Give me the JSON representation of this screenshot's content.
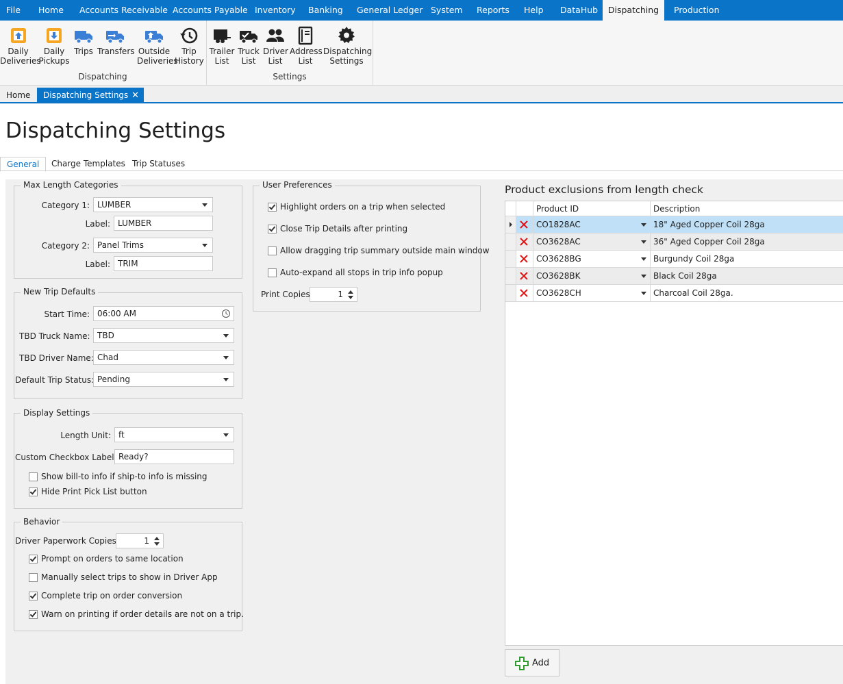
{
  "menu": [
    "File",
    "Home",
    "Accounts Receivable",
    "Accounts Payable",
    "Inventory",
    "Banking",
    "General Ledger",
    "System",
    "Reports",
    "Help",
    "DataHub",
    "Dispatching",
    "Production"
  ],
  "menu_active": "Dispatching",
  "ribbon": {
    "dispatching_group": "Dispatching",
    "settings_group": "Settings",
    "buttons": [
      {
        "l1": "Daily",
        "l2": "Deliveries",
        "icon": "daily-deliveries-icon"
      },
      {
        "l1": "Daily",
        "l2": "Pickups",
        "icon": "daily-pickups-icon"
      },
      {
        "l1": "Trips",
        "l2": "",
        "icon": "truck-icon"
      },
      {
        "l1": "Transfers",
        "l2": "",
        "icon": "transfer-truck-icon"
      },
      {
        "l1": "Outside",
        "l2": "Deliveries",
        "icon": "outside-delivery-truck-icon"
      },
      {
        "l1": "Trip",
        "l2": "History",
        "icon": "history-icon"
      },
      {
        "l1": "Trailer",
        "l2": "List",
        "icon": "trailer-icon"
      },
      {
        "l1": "Truck",
        "l2": "List",
        "icon": "truck-check-icon"
      },
      {
        "l1": "Driver",
        "l2": "List",
        "icon": "people-icon"
      },
      {
        "l1": "Address",
        "l2": "List",
        "icon": "address-book-icon"
      },
      {
        "l1": "Dispatching",
        "l2": "Settings",
        "icon": "gear-icon"
      }
    ]
  },
  "doc_tabs": {
    "home": "Home",
    "active": "Dispatching Settings",
    "close": "✕"
  },
  "page_title": "Dispatching Settings",
  "sub_tabs": [
    "General",
    "Charge Templates",
    "Trip Statuses"
  ],
  "max_length": {
    "title": "Max Length Categories",
    "cat1_label": "Category 1:",
    "cat1_value": "LUMBER",
    "label_label": "Label:",
    "label1_value": "LUMBER",
    "cat2_label": "Category 2:",
    "cat2_value": "Panel Trims",
    "label2_value": "TRIM"
  },
  "new_trip": {
    "title": "New Trip Defaults",
    "start_time_label": "Start Time:",
    "start_time": "06:00 AM",
    "truck_label": "TBD Truck Name:",
    "truck": "TBD",
    "driver_label": "TBD Driver Name:",
    "driver": "Chad",
    "status_label": "Default Trip Status:",
    "status": "Pending"
  },
  "display": {
    "title": "Display Settings",
    "length_unit_label": "Length Unit:",
    "length_unit": "ft",
    "checkbox_label_label": "Custom Checkbox Label:",
    "checkbox_label": "Ready?",
    "show_billto": "Show bill-to info if ship-to info is missing",
    "show_billto_checked": false,
    "hide_pick": "Hide Print Pick List button",
    "hide_pick_checked": true
  },
  "behavior": {
    "title": "Behavior",
    "copies_label": "Driver Paperwork Copies:",
    "copies": "1",
    "options": [
      {
        "label": "Prompt on orders to same location",
        "checked": true
      },
      {
        "label": "Manually select trips to show in Driver App",
        "checked": false
      },
      {
        "label": "Complete trip on order conversion",
        "checked": true
      },
      {
        "label": "Warn on printing if order details are not on a trip.",
        "checked": true
      }
    ]
  },
  "user_prefs": {
    "title": "User Preferences",
    "options": [
      {
        "label": "Highlight orders on a trip when selected",
        "checked": true
      },
      {
        "label": "Close Trip Details after printing",
        "checked": true
      },
      {
        "label": "Allow dragging trip summary outside main window",
        "checked": false
      },
      {
        "label": "Auto-expand all stops in trip info popup",
        "checked": false
      }
    ],
    "print_copies_label": "Print Copies:",
    "print_copies": "1"
  },
  "exclusions": {
    "title": "Product exclusions from length check",
    "col_product": "Product ID",
    "col_desc": "Description",
    "rows": [
      {
        "id": "CO1828AC",
        "desc": "18\" Aged Copper Coil 28ga"
      },
      {
        "id": "CO3628AC",
        "desc": "36\" Aged Copper Coil 28ga"
      },
      {
        "id": "CO3628BG",
        "desc": "Burgundy Coil 28ga"
      },
      {
        "id": "CO3628BK",
        "desc": "Black Coil 28ga"
      },
      {
        "id": "CO3628CH",
        "desc": "Charcoal Coil 28ga."
      }
    ],
    "add_label": "Add"
  },
  "colors": {
    "accent": "#0a74c9",
    "selected_row": "#bfe0f7",
    "delete": "#e01010",
    "add": "#2e9b2e",
    "ribbon_orange": "#f5a623"
  }
}
